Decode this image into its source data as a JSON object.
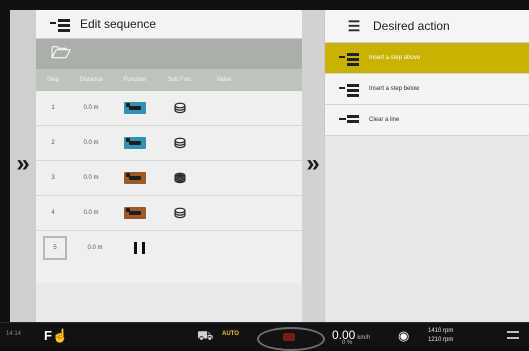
{
  "left_panel": {
    "title": "Edit sequence",
    "columns": [
      "Step",
      "Distance",
      "Function",
      "Sub Fun.",
      "Value"
    ],
    "rows": [
      {
        "step": "1",
        "distance": "0.0 m",
        "function_color": "#2f93b3",
        "function_icon": "function-block-blue",
        "sub_icon": "sub-function-default"
      },
      {
        "step": "2",
        "distance": "0.0 m",
        "function_color": "#2f93b3",
        "function_icon": "function-block-blue",
        "sub_icon": "sub-function-default"
      },
      {
        "step": "3",
        "distance": "0.0 m",
        "function_color": "#9e5a25",
        "function_icon": "function-block-brown",
        "sub_icon": "sub-function-single"
      },
      {
        "step": "4",
        "distance": "0.0 m",
        "function_color": "#9e5a25",
        "function_icon": "function-block-brown",
        "sub_icon": "sub-function-default"
      },
      {
        "step": "5",
        "distance": "0.0 m",
        "function_icon": "pause-icon"
      }
    ],
    "tool_icon": "open-folder-icon"
  },
  "right_panel": {
    "title": "Desired action",
    "actions": [
      {
        "label": "Insert a step above",
        "state": "active",
        "icon": "insert-step-icon"
      },
      {
        "label": "Insert a step below",
        "state": "normal",
        "icon": "insert-step-icon"
      },
      {
        "label": "Clear a line",
        "state": "normal",
        "icon": "clear-line-icon"
      }
    ]
  },
  "status_bar": {
    "time": "14:14",
    "auto_label": "AUTO",
    "speed": "0.00",
    "speed_unit": "km/h",
    "slip": "0 %",
    "rpm_1": "1410 rpm",
    "rpm_2": "1210 rpm"
  },
  "colors": {
    "accent_active": "#c9b300",
    "tool_header": "#a9b0a7"
  }
}
